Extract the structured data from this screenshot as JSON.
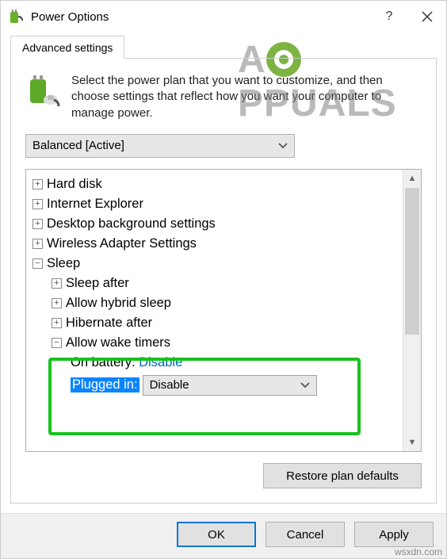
{
  "titlebar": {
    "title": "Power Options"
  },
  "tab": {
    "label": "Advanced settings"
  },
  "intro": "Select the power plan that you want to customize, and then choose settings that reflect how you want your computer to manage power.",
  "plan": {
    "selected": "Balanced [Active]"
  },
  "tree": {
    "hard_disk": "Hard disk",
    "ie": "Internet Explorer",
    "desktop_bg": "Desktop background settings",
    "wireless": "Wireless Adapter Settings",
    "sleep": "Sleep",
    "sleep_after": "Sleep after",
    "hybrid": "Allow hybrid sleep",
    "hibernate": "Hibernate after",
    "wake_timers": "Allow wake timers",
    "on_battery_label": "On battery:",
    "on_battery_value": "Disable",
    "plugged_in_label": "Plugged in:",
    "plugged_in_value": "Disable"
  },
  "buttons": {
    "restore": "Restore plan defaults",
    "ok": "OK",
    "cancel": "Cancel",
    "apply": "Apply"
  },
  "watermark": {
    "text": "PPUALS",
    "site": "wsxdn.com"
  }
}
